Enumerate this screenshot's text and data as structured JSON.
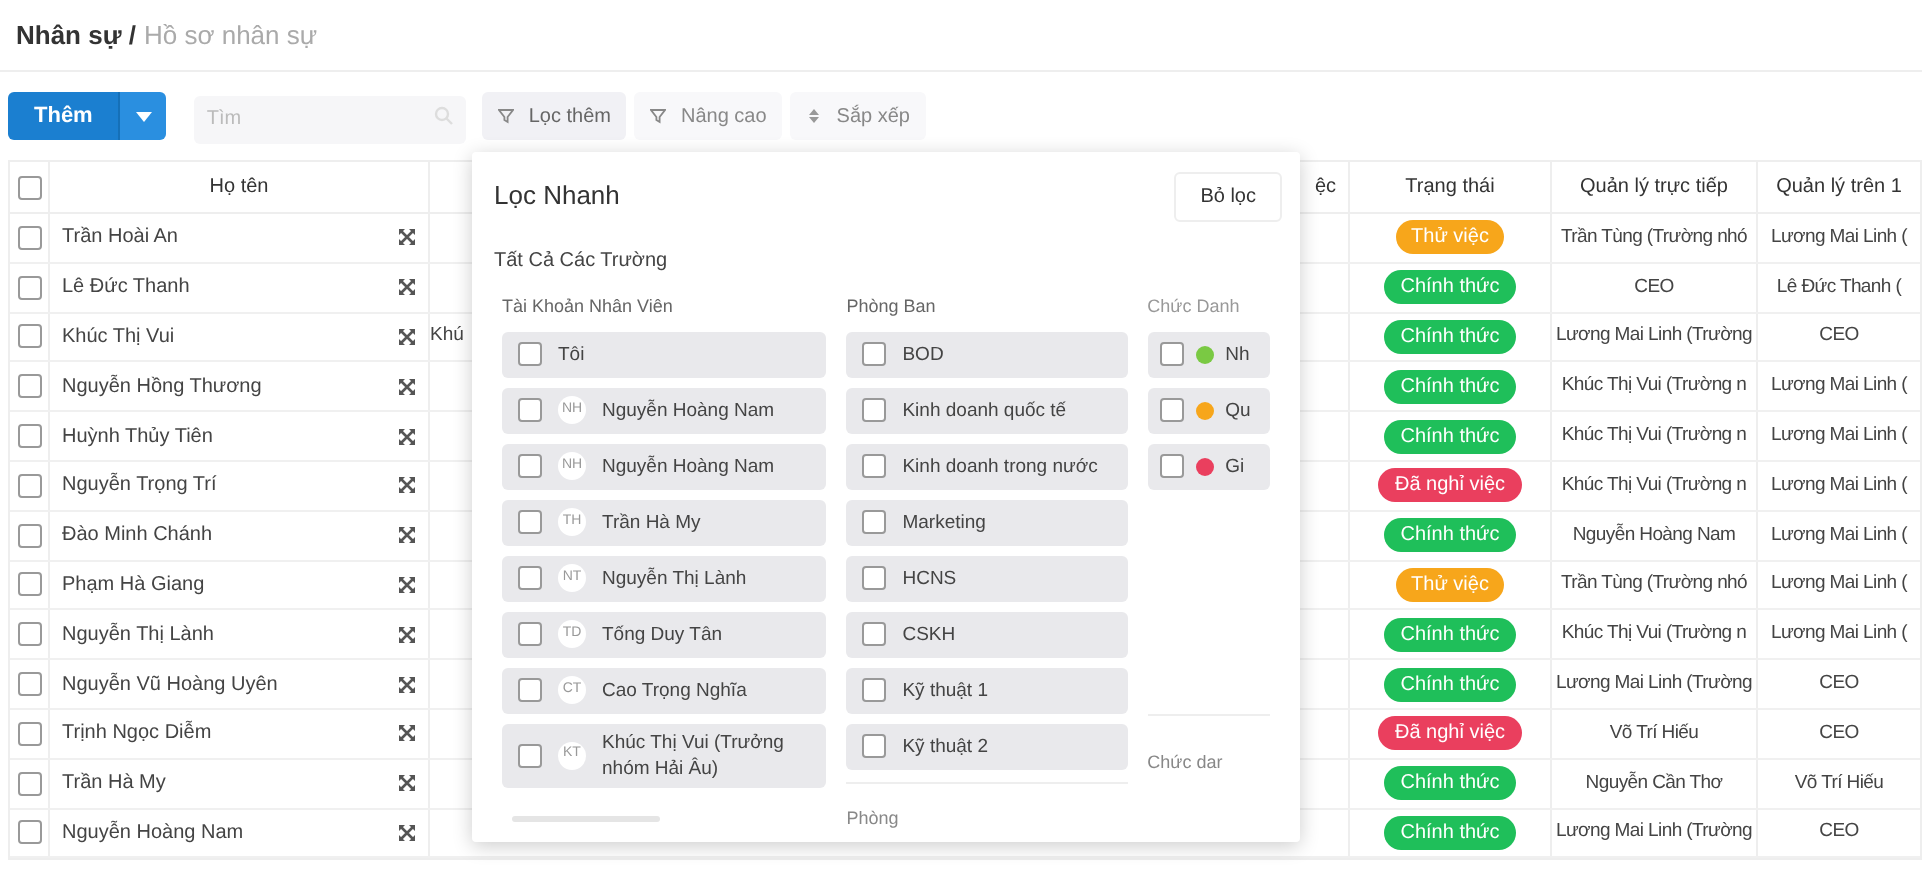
{
  "breadcrumb": {
    "parent": "Nhân sự /",
    "current": "Hồ sơ nhân sự"
  },
  "toolbar": {
    "add_button": "Thêm",
    "search": {
      "placeholder": "Tìm"
    },
    "buttons": [
      {
        "label": "Lọc thêm",
        "selected": true
      },
      {
        "label": "Nâng cao",
        "selected": false
      },
      {
        "label": "Sắp xếp",
        "selected": false
      }
    ]
  },
  "table": {
    "select_all_checked": false,
    "columns": {
      "name": "Họ tên",
      "column_4": "ệc",
      "status": "Trạng thái",
      "direct_manager": "Quản lý trực tiếp",
      "manager_above": "Quản lý trên 1"
    },
    "rows": [
      {
        "checked": false,
        "name": "Trần Hoài An",
        "status": {
          "label": "Thử việc",
          "color": "#f7a61b"
        },
        "direct_manager": "Trần Tùng (Trường nhó",
        "manager_above": "Lương Mai Linh ("
      },
      {
        "checked": false,
        "name": "Lê Đức Thanh",
        "status": {
          "label": "Chính thức",
          "color": "#1fbf5a"
        },
        "direct_manager": "CEO",
        "manager_above": "Lê Đức Thanh ("
      },
      {
        "checked": false,
        "name": "Khúc Thị Vui",
        "column_3": "Khú",
        "status": {
          "label": "Chính thức",
          "color": "#1fbf5a"
        },
        "direct_manager": "Lương Mai Linh (Trường",
        "manager_above": "CEO"
      },
      {
        "checked": false,
        "name": "Nguyễn Hồng Thương",
        "status": {
          "label": "Chính thức",
          "color": "#1fbf5a"
        },
        "direct_manager": "Khúc Thị Vui (Trường n",
        "manager_above": "Lương Mai Linh ("
      },
      {
        "checked": false,
        "name": "Huỳnh Thủy Tiên",
        "status": {
          "label": "Chính thức",
          "color": "#1fbf5a"
        },
        "direct_manager": "Khúc Thị Vui (Trường n",
        "manager_above": "Lương Mai Linh ("
      },
      {
        "checked": false,
        "name": "Nguyễn Trọng Trí",
        "status": {
          "label": "Đã nghỉ việc",
          "color": "#ea3f5e"
        },
        "direct_manager": "Khúc Thị Vui (Trường n",
        "manager_above": "Lương Mai Linh ("
      },
      {
        "checked": false,
        "name": "Đào Minh Chánh",
        "status": {
          "label": "Chính thức",
          "color": "#1fbf5a"
        },
        "direct_manager": "Nguyễn Hoàng Nam",
        "manager_above": "Lương Mai Linh ("
      },
      {
        "checked": false,
        "name": "Phạm Hà Giang",
        "status": {
          "label": "Thử việc",
          "color": "#f7a61b"
        },
        "direct_manager": "Trần Tùng (Trường nhó",
        "manager_above": "Lương Mai Linh ("
      },
      {
        "checked": false,
        "name": "Nguyễn Thị Lành",
        "status": {
          "label": "Chính thức",
          "color": "#1fbf5a"
        },
        "direct_manager": "Khúc Thị Vui (Trường n",
        "manager_above": "Lương Mai Linh ("
      },
      {
        "checked": false,
        "name": "Nguyễn Vũ Hoàng Uyên",
        "status": {
          "label": "Chính thức",
          "color": "#1fbf5a"
        },
        "direct_manager": "Lương Mai Linh (Trường",
        "manager_above": "CEO"
      },
      {
        "checked": false,
        "name": "Trịnh Ngọc Diễm",
        "status": {
          "label": "Đã nghỉ việc",
          "color": "#ea3f5e"
        },
        "direct_manager": "Võ Trí Hiếu",
        "manager_above": "CEO"
      },
      {
        "checked": false,
        "name": "Trần Hà My",
        "status": {
          "label": "Chính thức",
          "color": "#1fbf5a"
        },
        "direct_manager": "Nguyễn Cần Thơ",
        "manager_above": "Võ Trí Hiếu"
      },
      {
        "checked": false,
        "name": "Nguyễn Hoàng Nam",
        "status": {
          "label": "Chính thức",
          "color": "#1fbf5a"
        },
        "direct_manager": "Lương Mai Linh (Trường",
        "manager_above": "CEO"
      }
    ]
  },
  "quick_filter": {
    "title": "Lọc Nhanh",
    "clear_button": "Bỏ lọc",
    "section": "Tất Cả Các Trường",
    "accounts": {
      "heading": "Tài Khoản Nhân Viên",
      "items": [
        {
          "label": "Tôi",
          "checked": false
        },
        {
          "initials": "NH",
          "label": "Nguyễn Hoàng Nam",
          "checked": false
        },
        {
          "initials": "NH",
          "label": "Nguyễn Hoàng Nam",
          "checked": false
        },
        {
          "initials": "TH",
          "label": "Trần Hà My",
          "checked": false
        },
        {
          "initials": "NT",
          "label": "Nguyễn Thị Lành",
          "checked": false
        },
        {
          "initials": "TD",
          "label": "Tống Duy Tân",
          "checked": false
        },
        {
          "initials": "CT",
          "label": "Cao Trọng Nghĩa",
          "checked": false
        },
        {
          "initials": "KT",
          "label": "Khúc Thị Vui (Trưởng nhóm Hải Âu)",
          "checked": false
        }
      ]
    },
    "departments": {
      "heading": "Phòng Ban",
      "items": [
        {
          "label": "BOD",
          "checked": false
        },
        {
          "label": "Kinh doanh quốc tế",
          "checked": false
        },
        {
          "label": "Kinh doanh trong nước",
          "checked": false
        },
        {
          "label": "Marketing",
          "checked": false
        },
        {
          "label": "HCNS",
          "checked": false
        },
        {
          "label": "CSKH",
          "checked": false
        },
        {
          "label": "Kỹ thuật 1",
          "checked": false
        },
        {
          "label": "Kỹ thuật 2",
          "checked": false
        }
      ],
      "next_heading": "Phòng"
    },
    "titles": {
      "heading": "Chức Danh",
      "items": [
        {
          "label": "Nh",
          "color": "#7ac943",
          "checked": false
        },
        {
          "label": "Qu",
          "color": "#f7a61b",
          "checked": false
        },
        {
          "label": "Gi",
          "color": "#ea3f5e",
          "checked": false
        }
      ],
      "next_heading": "Chức dar"
    }
  }
}
